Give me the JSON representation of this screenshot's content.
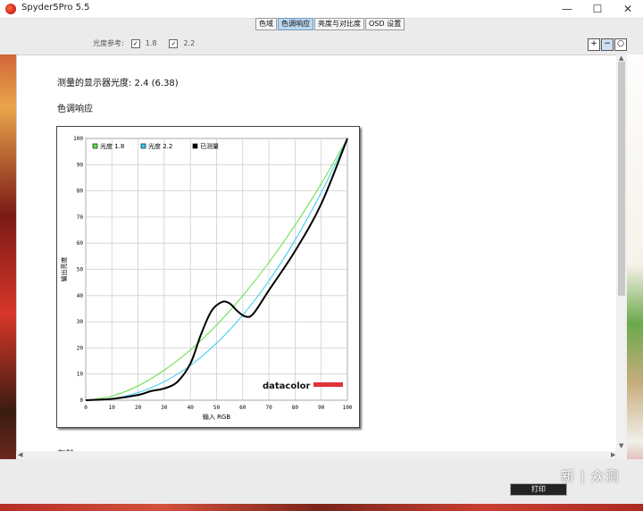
{
  "window": {
    "title": "Spyder5Pro 5.5",
    "controls": [
      "—",
      "☐",
      "✕"
    ]
  },
  "tabs": [
    {
      "label": "色域",
      "active": false
    },
    {
      "label": "色调响应",
      "active": true
    },
    {
      "label": "亮度与对比度",
      "active": false
    },
    {
      "label": "OSD 设置",
      "active": false
    }
  ],
  "gamma_reference": {
    "label": "光度参考:",
    "options": [
      {
        "value": "1.8",
        "checked": true
      },
      {
        "value": "2.2",
        "checked": true
      }
    ]
  },
  "zoom_icons": [
    "zoom-in-icon",
    "zoom-out-icon",
    "zoom-fit-icon"
  ],
  "report": {
    "measured_gamma": "测量的显示器光度:  2.4 (6.38)",
    "section_title": "色调响应",
    "next_section_cutoff": "灰阶"
  },
  "chart_data": {
    "type": "line",
    "xlabel": "输入 RGB",
    "ylabel": "输出亮度",
    "xlim": [
      0,
      100
    ],
    "ylim": [
      0,
      100
    ],
    "xticks": [
      0,
      10,
      20,
      30,
      40,
      50,
      60,
      70,
      80,
      90,
      100
    ],
    "yticks": [
      0,
      10,
      20,
      30,
      40,
      50,
      60,
      70,
      80,
      90,
      100
    ],
    "grid": true,
    "legend_position": "top-left",
    "logo": "datacolor",
    "series": [
      {
        "name": "光度 1.8",
        "color": "#66dd44",
        "x": [
          0,
          10,
          20,
          30,
          40,
          50,
          60,
          70,
          80,
          90,
          100
        ],
        "y": [
          0,
          1.6,
          5.5,
          11.5,
          19.2,
          28.7,
          39.9,
          52.6,
          66.9,
          82.7,
          100
        ]
      },
      {
        "name": "光度 2.2",
        "color": "#33ccee",
        "x": [
          0,
          10,
          20,
          30,
          40,
          50,
          60,
          70,
          80,
          90,
          100
        ],
        "y": [
          0,
          0.6,
          2.9,
          7.1,
          13.3,
          21.8,
          32.5,
          45.6,
          61.2,
          79.3,
          100
        ]
      },
      {
        "name": "已测量",
        "color": "#000000",
        "x": [
          0,
          10,
          20,
          25,
          30,
          35,
          40,
          44,
          48,
          52,
          55,
          58,
          61,
          64,
          70,
          80,
          90,
          100
        ],
        "y": [
          0,
          0.5,
          2,
          3.5,
          4.5,
          7,
          14,
          25,
          34,
          37.5,
          37,
          34,
          32,
          33,
          42,
          57,
          75,
          100
        ]
      }
    ]
  },
  "bottom": {
    "print_label": "打印",
    "watermark": "新 | 众测"
  }
}
